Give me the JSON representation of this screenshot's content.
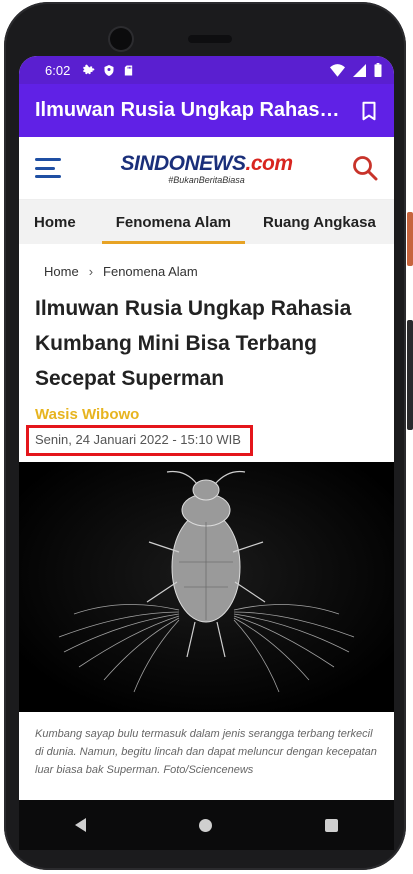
{
  "statusbar": {
    "time": "6:02"
  },
  "appbar": {
    "title": "Ilmuwan Rusia Ungkap Rahasia..."
  },
  "site": {
    "brand_main": "SINDONEWS",
    "brand_com": ".com",
    "tagline": "#BukanBeritaBiasa"
  },
  "tabs": [
    {
      "label": "Home"
    },
    {
      "label": "Fenomena Alam"
    },
    {
      "label": "Ruang Angkasa"
    }
  ],
  "breadcrumb": {
    "home": "Home",
    "sep": "›",
    "current": "Fenomena Alam"
  },
  "article": {
    "headline": "Ilmuwan Rusia Ungkap Rahasia Kumbang Mini Bisa Terbang Secepat Superman",
    "author": "Wasis Wibowo",
    "date": "Senin, 24 Januari 2022 - 15:10 WIB",
    "caption": "Kumbang sayap bulu termasuk dalam jenis serangga terbang terkecil di dunia. Namun, begitu lincah dan dapat meluncur dengan kecepatan luar biasa bak Superman. Foto/Sciencenews"
  },
  "colors": {
    "statusbar": "#5a1fd0",
    "appbar": "#6021e6",
    "accent_tab": "#e7a325",
    "author": "#e7b41f",
    "highlight_box": "#e4161b"
  }
}
